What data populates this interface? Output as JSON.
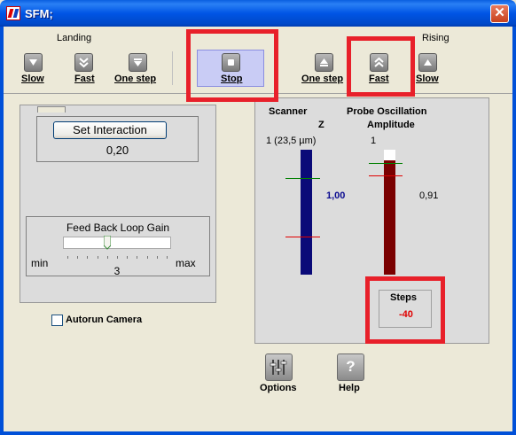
{
  "window": {
    "title": "SFM;",
    "close_glyph": "✕"
  },
  "toolbar": {
    "landing_label": "Landing",
    "rising_label": "Rising",
    "landing": [
      {
        "label": "Slow",
        "icon": "triangle-down-icon"
      },
      {
        "label": "Fast",
        "icon": "double-chevron-down-icon"
      },
      {
        "label": "One step",
        "icon": "triangle-down-bar-icon"
      }
    ],
    "stop": {
      "label": "Stop",
      "icon": "stop-square-icon",
      "active": true
    },
    "rising": [
      {
        "label": "One step",
        "icon": "triangle-up-bar-icon"
      },
      {
        "label": "Fast",
        "icon": "double-chevron-up-icon"
      },
      {
        "label": "Slow",
        "icon": "triangle-up-icon"
      }
    ]
  },
  "interaction": {
    "button_label": "Set Interaction",
    "value": "0,20"
  },
  "feedback": {
    "title": "Feed Back Loop Gain",
    "min_label": "min",
    "max_label": "max",
    "value": "3",
    "level_fraction": 0.4
  },
  "autorun": {
    "label": "Autorun Camera",
    "checked": false
  },
  "scanner": {
    "title": "Scanner",
    "axis": "Z",
    "range_label": "1 (23,5 µm)",
    "value": "1,00"
  },
  "probe": {
    "title_line1": "Probe Oscillation",
    "title_line2": "Amplitude",
    "range_label": "1",
    "value": "0,91"
  },
  "steps": {
    "label": "Steps",
    "value": "-40",
    "value_color": "#e00000"
  },
  "bottom": {
    "options_label": "Options",
    "help_label": "Help",
    "help_glyph": "?"
  },
  "colors": {
    "highlight": "#e8202a",
    "stop_active": "#c9ccf5",
    "scanner_bar": "#0a0a78",
    "probe_bar": "#7a0000",
    "marker_green": "#008000",
    "marker_red": "#e00000"
  }
}
